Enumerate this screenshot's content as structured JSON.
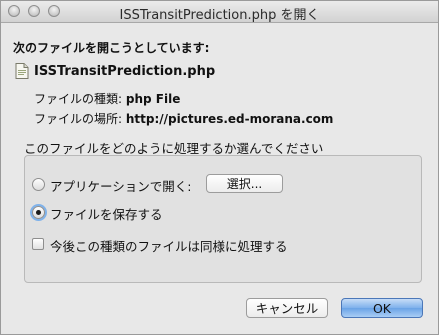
{
  "window": {
    "title": "ISSTransitPrediction.php を開く"
  },
  "dialog": {
    "heading": "次のファイルを開こうとしています:",
    "file_icon": "document-icon",
    "file_name": "ISSTransitPrediction.php",
    "type_label": "ファイルの種類:",
    "type_value": "php File",
    "location_label": "ファイルの場所:",
    "location_value": "http://pictures.ed-morana.com",
    "question": "このファイルをどのように処理するか選んでください",
    "options": {
      "open_with_label": "アプリケーションで開く:",
      "choose_button": "選択...",
      "save_label": "ファイルを保存する",
      "remember_label": "今後この種類のファイルは同様に処理する"
    },
    "state": {
      "selected_option": "save",
      "remember_checked": false
    },
    "buttons": {
      "cancel": "キャンセル",
      "ok": "OK"
    }
  },
  "colors": {
    "ok_button": "#7eb1ec",
    "focus_ring": "#7fb2ea"
  }
}
